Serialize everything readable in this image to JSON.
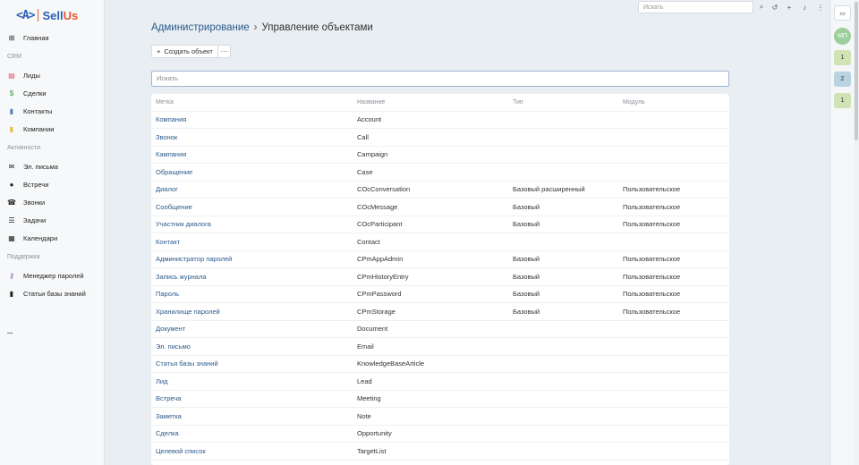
{
  "brand": {
    "mark": "<A>",
    "name_a": "Sell",
    "name_b": "Us"
  },
  "nav": {
    "home": "Главная",
    "crm_title": "CRM",
    "crm": [
      "Лиды",
      "Сделки",
      "Контакты",
      "Компании"
    ],
    "activity_title": "Активности",
    "activity": [
      "Эл. письма",
      "Встречи",
      "Звонки",
      "Задачи",
      "Календари"
    ],
    "support_title": "Поддержка",
    "support": [
      "Менеджер паролей",
      "Статьи базы знаний"
    ],
    "more": "..."
  },
  "topbar": {
    "search_placeholder": "Искать"
  },
  "rail": {
    "avatar": "МП",
    "badges": [
      "1",
      "2",
      "1"
    ]
  },
  "breadcrumb": {
    "parent": "Администрирование",
    "sep": "›",
    "current": "Управление объектами"
  },
  "actions": {
    "create": "Создать объект",
    "create_icon": "+",
    "more": "···"
  },
  "filter": {
    "placeholder": "Искать"
  },
  "table": {
    "headers": [
      "Метка",
      "Название",
      "Тип",
      "Модуль"
    ],
    "rows": [
      [
        "Компания",
        "Account",
        "",
        ""
      ],
      [
        "Звонок",
        "Call",
        "",
        ""
      ],
      [
        "Кампания",
        "Campaign",
        "",
        ""
      ],
      [
        "Обращение",
        "Case",
        "",
        ""
      ],
      [
        "Диалог",
        "COcConversation",
        "Базовый расширенный",
        "Пользовательское"
      ],
      [
        "Сообщение",
        "COcMessage",
        "Базовый",
        "Пользовательское"
      ],
      [
        "Участник диалога",
        "COcParticipant",
        "Базовый",
        "Пользовательское"
      ],
      [
        "Контакт",
        "Contact",
        "",
        ""
      ],
      [
        "Администратор паролей",
        "CPmAppAdmin",
        "Базовый",
        "Пользовательское"
      ],
      [
        "Запись журнала",
        "CPmHistoryEntry",
        "Базовый",
        "Пользовательское"
      ],
      [
        "Пароль",
        "CPmPassword",
        "Базовый",
        "Пользовательское"
      ],
      [
        "Хранилище паролей",
        "CPmStorage",
        "Базовый",
        "Пользовательское"
      ],
      [
        "Документ",
        "Document",
        "",
        ""
      ],
      [
        "Эл. письмо",
        "Email",
        "",
        ""
      ],
      [
        "Статья базы знаний",
        "KnowledgeBaseArticle",
        "",
        ""
      ],
      [
        "Лид",
        "Lead",
        "",
        ""
      ],
      [
        "Встреча",
        "Meeting",
        "",
        ""
      ],
      [
        "Заметка",
        "Note",
        "",
        ""
      ],
      [
        "Сделка",
        "Opportunity",
        "",
        ""
      ],
      [
        "Целевой список",
        "TargetList",
        "",
        ""
      ]
    ]
  }
}
